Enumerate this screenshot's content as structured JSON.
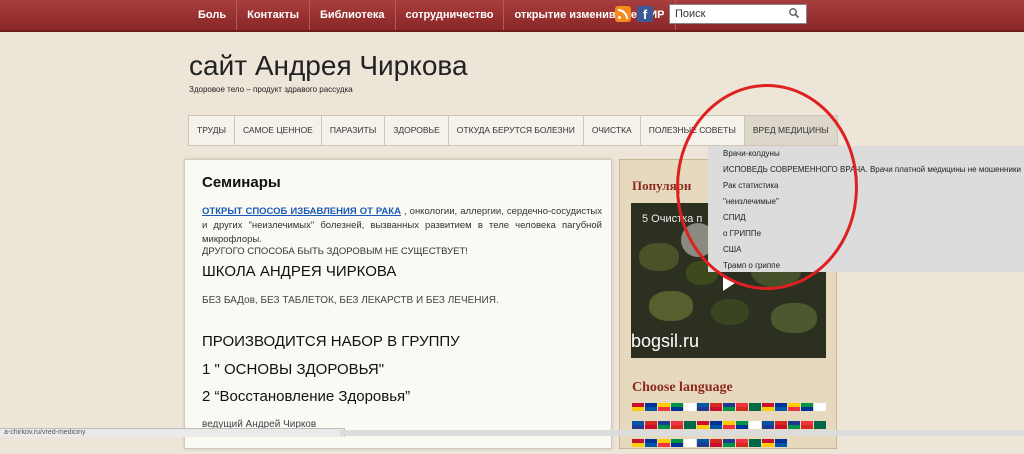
{
  "topnav": [
    "Боль",
    "Контакты",
    "Библиотека",
    "сотрудничество",
    "открытие изменившее МИР"
  ],
  "search": {
    "placeholder": "Поиск"
  },
  "site": {
    "title": "сайт Андрея Чиркова",
    "tagline": "Здоровое тело – продукт здравого рассудка"
  },
  "mainnav": [
    "ТРУДЫ",
    "САМОЕ ЦЕННОЕ",
    "ПАРАЗИТЫ",
    "ЗДОРОВЬЕ",
    "ОТКУДА БЕРУТСЯ БОЛЕЗНИ",
    "ОЧИСТКА",
    "ПОЛЕЗНЫЕ СОВЕТЫ",
    "ВРЕД МЕДИЦИНЫ"
  ],
  "dropdown": [
    "Врачи-колдуны",
    "ИСПОВЕДЬ СОВРЕМЕННОГО ВРАЧА. Врачи платной медицины не мошенники",
    "Рак статистика",
    "\"неизлечимые\"",
    "СПИД",
    "о ГРИППе",
    "США",
    "Трамп о гриппе"
  ],
  "content": {
    "heading": "Семинары",
    "link": "ОТКРЫТ СПОСОБ ИЗБАВЛЕНИЯ ОТ РАКА",
    "para_rest": " , онкологии, аллергии, сердечно-сосудистых и других \"неизлечимых\" болезней, вызванных развитием в теле человека пагубной микрофлоры.",
    "line2": "ДРУГОГО СПОСОБА БЫТЬ ЗДОРОВЫМ НЕ СУЩЕСТВУЕТ!",
    "school": "ШКОЛА АНДРЕЯ ЧИРКОВА",
    "nomeds": "БЕЗ БАДов, БЕЗ ТАБЛЕТОК, БЕЗ ЛЕКАРСТВ И БЕЗ ЛЕЧЕНИЯ.",
    "recruit": "ПРОИЗВОДИТСЯ НАБОР В ГРУППУ",
    "course1": "1 \" ОСНОВЫ ЗДОРОВЬЯ\"",
    "course2": "2 “Восстановление Здоровья”",
    "lead": "ведущий  Андрей Чирков"
  },
  "sidebar": {
    "popular": "Популярн",
    "video_title": "5 Очистка п",
    "video_brand": "bogsil.ru",
    "lang": "Choose language"
  },
  "statusbar": "a-chirkov.ru/vred-mediciny",
  "colors": {
    "topbar": "#8b2727",
    "link": "#1a5bb8",
    "sidebar_title": "#8c2a1d",
    "annotation": "#e02020"
  },
  "icons": [
    "rss-icon",
    "facebook-icon",
    "search-icon",
    "play-icon",
    "flag-icon"
  ]
}
